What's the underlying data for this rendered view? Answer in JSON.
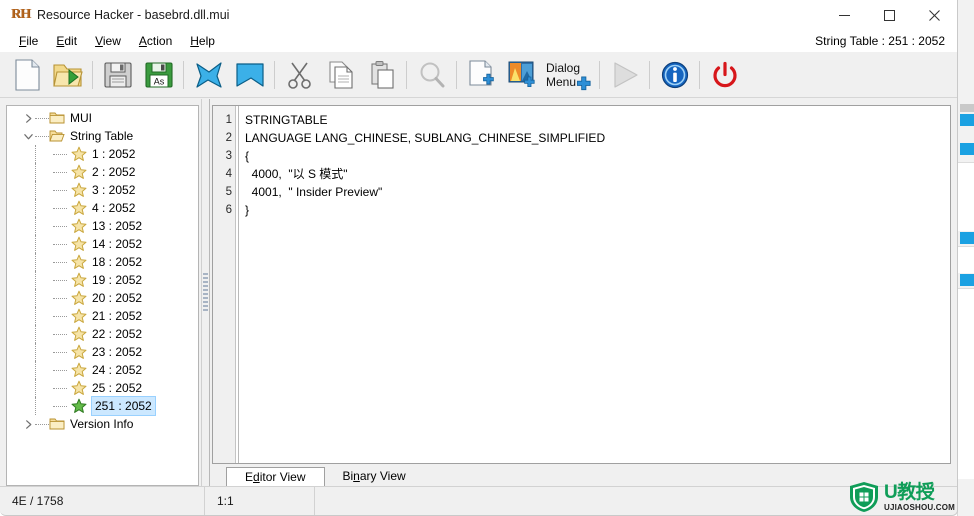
{
  "window": {
    "title": "Resource Hacker - basebrd.dll.mui",
    "app_icon": "RH",
    "minimize_label": "minimize",
    "maximize_label": "maximize",
    "close_label": "close"
  },
  "menu": {
    "items": [
      {
        "pre": "",
        "accel": "F",
        "post": "ile"
      },
      {
        "pre": "",
        "accel": "E",
        "post": "dit"
      },
      {
        "pre": "",
        "accel": "V",
        "post": "iew"
      },
      {
        "pre": "",
        "accel": "A",
        "post": "ction"
      },
      {
        "pre": "",
        "accel": "H",
        "post": "elp"
      }
    ],
    "status_caption": "String Table : 251 : 2052"
  },
  "toolbar": {
    "buttons": [
      {
        "name": "new-file-icon",
        "title": "New"
      },
      {
        "name": "open-file-icon",
        "title": "Open"
      },
      {
        "name": "save-icon",
        "title": "Save"
      },
      {
        "name": "save-as-icon",
        "title": "Save As",
        "badge": "As"
      },
      {
        "name": "import-icon",
        "title": "Import"
      },
      {
        "name": "export-icon",
        "title": "Export"
      },
      {
        "name": "cut-icon",
        "title": "Cut"
      },
      {
        "name": "copy-icon",
        "title": "Copy"
      },
      {
        "name": "paste-icon",
        "title": "Paste"
      },
      {
        "name": "search-icon",
        "title": "Find"
      },
      {
        "name": "add-resource-icon",
        "title": "Add Resource"
      },
      {
        "name": "add-image-icon",
        "title": "Add Image"
      },
      {
        "name": "dialog-menu-icon",
        "title": "Dialog Menu",
        "line1": "Dialog",
        "line2": "Menu"
      },
      {
        "name": "run-icon",
        "title": "Run"
      },
      {
        "name": "info-icon",
        "title": "Info"
      },
      {
        "name": "exit-icon",
        "title": "Exit"
      }
    ]
  },
  "tree": {
    "nodes": [
      {
        "label": "MUI",
        "level": 0,
        "icon": "folder-icon",
        "expander": "collapsed",
        "selected": false
      },
      {
        "label": "String Table",
        "level": 0,
        "icon": "folder-open-icon",
        "expander": "expanded",
        "selected": false
      },
      {
        "label": "1 : 2052",
        "level": 1,
        "icon": "star-icon",
        "expander": "none",
        "selected": false
      },
      {
        "label": "2 : 2052",
        "level": 1,
        "icon": "star-icon",
        "expander": "none",
        "selected": false
      },
      {
        "label": "3 : 2052",
        "level": 1,
        "icon": "star-icon",
        "expander": "none",
        "selected": false
      },
      {
        "label": "4 : 2052",
        "level": 1,
        "icon": "star-icon",
        "expander": "none",
        "selected": false
      },
      {
        "label": "13 : 2052",
        "level": 1,
        "icon": "star-icon",
        "expander": "none",
        "selected": false
      },
      {
        "label": "14 : 2052",
        "level": 1,
        "icon": "star-icon",
        "expander": "none",
        "selected": false
      },
      {
        "label": "18 : 2052",
        "level": 1,
        "icon": "star-icon",
        "expander": "none",
        "selected": false
      },
      {
        "label": "19 : 2052",
        "level": 1,
        "icon": "star-icon",
        "expander": "none",
        "selected": false
      },
      {
        "label": "20 : 2052",
        "level": 1,
        "icon": "star-icon",
        "expander": "none",
        "selected": false
      },
      {
        "label": "21 : 2052",
        "level": 1,
        "icon": "star-icon",
        "expander": "none",
        "selected": false
      },
      {
        "label": "22 : 2052",
        "level": 1,
        "icon": "star-icon",
        "expander": "none",
        "selected": false
      },
      {
        "label": "23 : 2052",
        "level": 1,
        "icon": "star-icon",
        "expander": "none",
        "selected": false
      },
      {
        "label": "24 : 2052",
        "level": 1,
        "icon": "star-icon",
        "expander": "none",
        "selected": false
      },
      {
        "label": "25 : 2052",
        "level": 1,
        "icon": "star-icon",
        "expander": "none",
        "selected": false
      },
      {
        "label": "251 : 2052",
        "level": 1,
        "icon": "star-icon-selected",
        "expander": "none",
        "selected": true
      },
      {
        "label": "Version Info",
        "level": 0,
        "icon": "folder-icon",
        "expander": "collapsed",
        "selected": false
      }
    ]
  },
  "editor": {
    "lines": [
      {
        "num": "1",
        "text": "STRINGTABLE"
      },
      {
        "num": "2",
        "text": "LANGUAGE LANG_CHINESE, SUBLANG_CHINESE_SIMPLIFIED"
      },
      {
        "num": "3",
        "text": "{"
      },
      {
        "num": "4",
        "text": "  4000,  \"以 S 模式\""
      },
      {
        "num": "5",
        "text": "  4001,  \" Insider Preview\""
      },
      {
        "num": "6",
        "text": "}"
      }
    ]
  },
  "tabs": [
    {
      "pre": "E",
      "accel": "d",
      "post": "itor View",
      "active": true
    },
    {
      "pre": "Bi",
      "accel": "n",
      "post": "ary View",
      "active": false
    }
  ],
  "statusbar": {
    "size": "4E / 1758",
    "caret": "1:1",
    "extra": ""
  },
  "watermark": {
    "main": "U教授",
    "sub": "UJIAOSHOU.COM"
  },
  "colors": {
    "accent_blue": "#1ba1e2",
    "selection": "#cce8ff",
    "toolbar_bg": "#f0f0f0",
    "watermark_green": "#0f9d58",
    "close_hover": "#e81123"
  }
}
